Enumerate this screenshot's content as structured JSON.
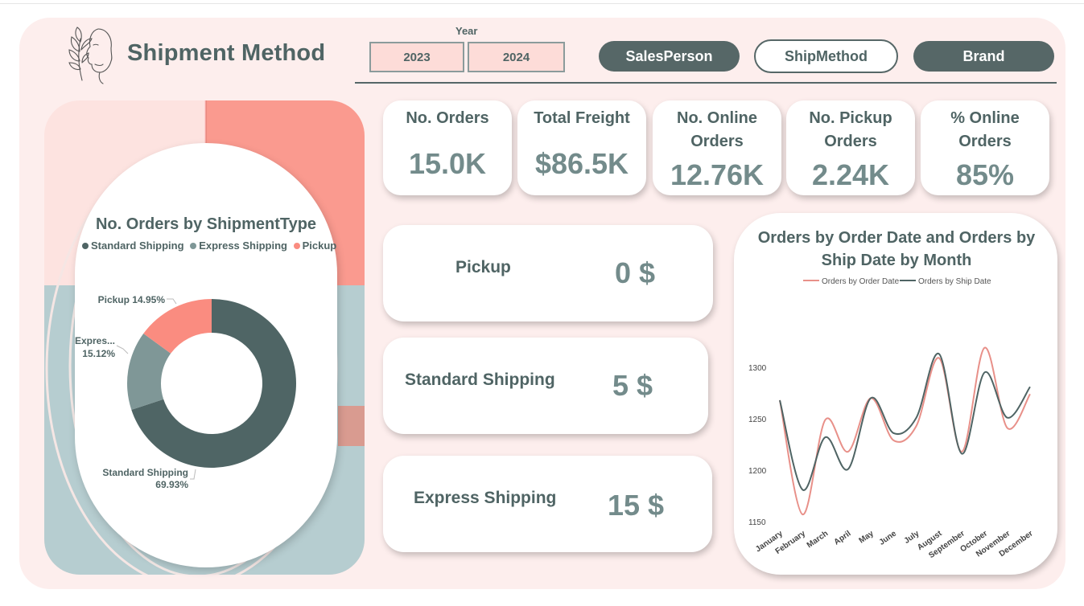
{
  "header": {
    "title": "Shipment Method",
    "year_label": "Year",
    "years": [
      "2023",
      "2024"
    ],
    "nav": [
      "SalesPerson",
      "ShipMethod",
      "Brand"
    ]
  },
  "kpis": [
    {
      "title_lines": [
        "No. Orders"
      ],
      "value": "15.0K"
    },
    {
      "title_lines": [
        "Total Freight"
      ],
      "value": "$86.5K"
    },
    {
      "title_lines": [
        "No. Online",
        "Orders"
      ],
      "value": "12.76K"
    },
    {
      "title_lines": [
        "No. Pickup",
        "Orders"
      ],
      "value": "2.24K"
    },
    {
      "title_lines": [
        "% Online",
        "Orders"
      ],
      "value": "85%"
    }
  ],
  "shipping": [
    {
      "name": "Pickup",
      "value": "0 $"
    },
    {
      "name": "Standard Shipping",
      "value": "5 $"
    },
    {
      "name": "Express Shipping",
      "value": "15 $"
    }
  ],
  "colors": {
    "accent_dark": "#566767",
    "salmon": "#fa8c80",
    "express": "#7f9797",
    "panel_bg": "#fdeeed",
    "order_line": "#e89089",
    "ship_line": "#4f6464"
  },
  "chart_data": [
    {
      "type": "pie",
      "title": "No. Orders by ShipmentType",
      "legend": [
        "Standard Shipping",
        "Express Shipping",
        "Pickup"
      ],
      "legend_position": "top",
      "slices": [
        {
          "label": "Standard Shipping",
          "value": 69.93,
          "display": "69.93%",
          "color": "#4f6565"
        },
        {
          "label": "Express Shipping",
          "short_label": "Expres...",
          "value": 15.12,
          "display": "15.12%",
          "color": "#7f9797"
        },
        {
          "label": "Pickup",
          "value": 14.95,
          "display": "14.95%",
          "color": "#fa8c80"
        }
      ]
    },
    {
      "type": "line",
      "title": "Orders by Order Date and Orders by Ship Date by Month",
      "legend_position": "top",
      "categories": [
        "January",
        "February",
        "March",
        "April",
        "May",
        "June",
        "July",
        "August",
        "September",
        "October",
        "November",
        "December"
      ],
      "series": [
        {
          "name": "Orders by Order Date",
          "color": "#e89089",
          "values": [
            1268,
            1157,
            1249,
            1218,
            1270,
            1229,
            1243,
            1309,
            1218,
            1319,
            1241,
            1274
          ]
        },
        {
          "name": "Orders by Ship Date",
          "color": "#4f6464",
          "values": [
            1268,
            1181,
            1232,
            1201,
            1270,
            1236,
            1251,
            1313,
            1216,
            1295,
            1251,
            1281
          ]
        }
      ],
      "ylim": [
        1150,
        1300
      ],
      "yticks": [
        1150,
        1200,
        1250,
        1300
      ],
      "grid": false
    }
  ]
}
